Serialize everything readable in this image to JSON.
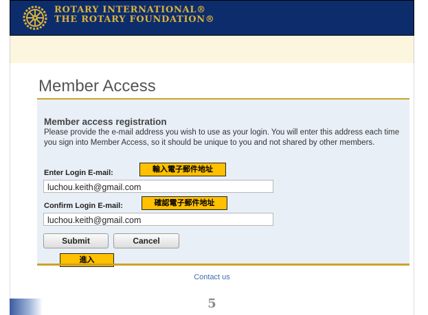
{
  "header": {
    "brand_line1": "ROTARY INTERNATIONAL®",
    "brand_line2": "THE ROTARY FOUNDATION®"
  },
  "page": {
    "title": "Member Access"
  },
  "registration": {
    "heading": "Member access registration",
    "description": "Please provide the e-mail address you wish to use as your login. You will enter this address each time you sign into Member Access, so it should be unique to you and not shared by other members.",
    "email_label": "Enter Login E-mail:",
    "email_value": "luchou.keith@gmail.com",
    "confirm_label": "Confirm Login E-mail:",
    "confirm_value": "luchou.keith@gmail.com"
  },
  "annotations": {
    "email_tag": "輸入電子郵件地址",
    "confirm_tag": "確認電子郵件地址",
    "submit_tag": "進入"
  },
  "buttons": {
    "submit": "Submit",
    "cancel": "Cancel"
  },
  "footer": {
    "contact": "Contact us",
    "page_number": "5"
  },
  "colors": {
    "header_bg": "#0d2c6c",
    "brand_gold": "#d9b23a",
    "accent_gold": "#c9a227",
    "panel_bg": "#e9eff7",
    "annotation_bg": "#ffc000",
    "link": "#3b6cae"
  }
}
